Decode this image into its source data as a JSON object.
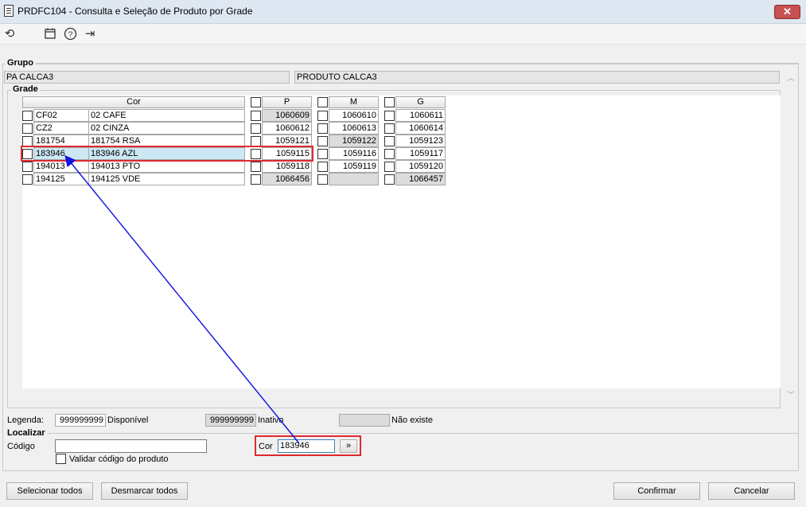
{
  "window": {
    "title": "PRDFC104 - Consulta e Seleção de Produto por Grade",
    "close_label": "✕"
  },
  "toolbar": {
    "refresh_glyph": "⟲",
    "calendar_glyph": "🗓",
    "help_glyph": "?",
    "exit_glyph": "⇥"
  },
  "grupo": {
    "label": "Grupo",
    "code": "PA CALCA3",
    "description": "PRODUTO CALCA3"
  },
  "grade": {
    "label": "Grade",
    "cor_header": "Cor",
    "size_headers": [
      "P",
      "M",
      "G"
    ],
    "rows": [
      {
        "code": "CF02",
        "name": "02 CAFE",
        "p": "1060609",
        "m": "1060610",
        "g": "1060611"
      },
      {
        "code": "CZ2",
        "name": "02 CINZA",
        "p": "1060612",
        "m": "1060613",
        "g": "1060614"
      },
      {
        "code": "181754",
        "name": "181754 RSA",
        "p": "1059121",
        "m": "1059122",
        "g": "1059123"
      },
      {
        "code": "183946",
        "name": "183946 AZL",
        "p": "1059115",
        "m": "1059116",
        "g": "1059117"
      },
      {
        "code": "194013",
        "name": "194013 PTO",
        "p": "1059118",
        "m": "1059119",
        "g": "1059120"
      },
      {
        "code": "194125",
        "name": "194125 VDE",
        "p": "1066456",
        "m": "",
        "g": "1066457"
      }
    ]
  },
  "legenda": {
    "label": "Legenda:",
    "sample": "999999999",
    "available_label": "Disponível",
    "inactive_label": "Inativo",
    "not_exists_label": "Não existe"
  },
  "localizar": {
    "label": "Localizar",
    "codigo_label": "Código",
    "codigo_value": "",
    "validar_label": "Validar código do produto",
    "cor_label": "Cor",
    "cor_value": "183946",
    "go_label": "»"
  },
  "buttons": {
    "select_all": "Selecionar todos",
    "deselect_all": "Desmarcar todos",
    "confirm": "Confirmar",
    "cancel": "Cancelar"
  },
  "colors": {
    "highlight_box": "#e0292f",
    "arrow": "#1010e0",
    "selected_row": "#cce8f4"
  }
}
